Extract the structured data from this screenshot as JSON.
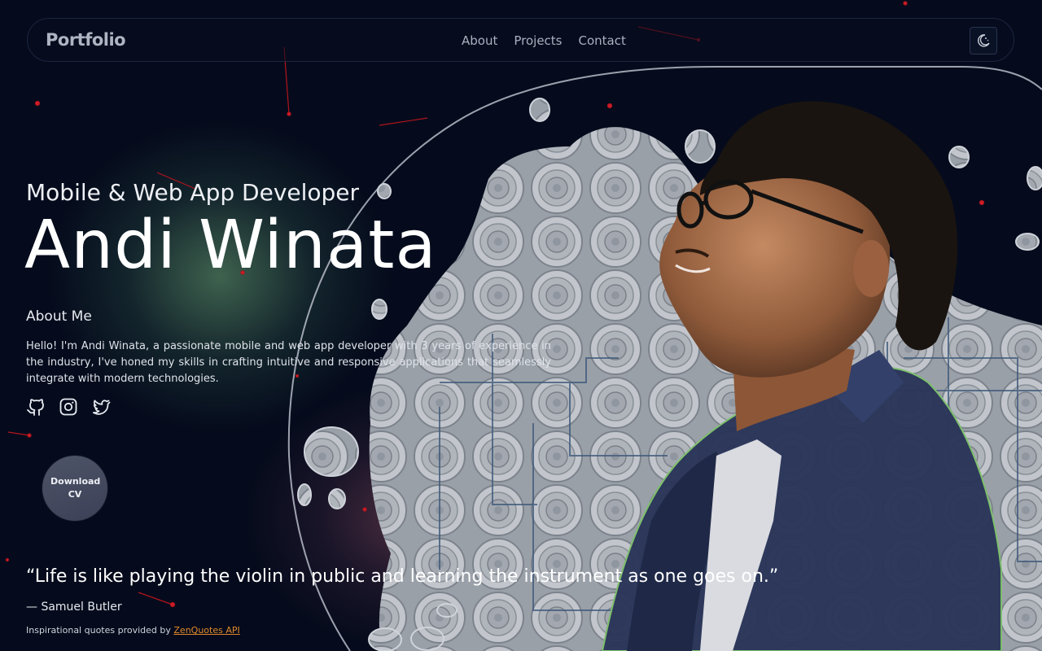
{
  "brand": {
    "logo": "Portfolio"
  },
  "nav": {
    "links": [
      "About",
      "Projects",
      "Contact"
    ],
    "theme_toggle_icon": "moon-icon"
  },
  "hero": {
    "subtitle": "Mobile & Web App Developer",
    "name": "Andi Winata",
    "about_heading": "About Me",
    "about_text": "Hello! I'm Andi Winata, a passionate mobile and web app developer with 3 years of experience in the industry, I've honed my skills in crafting intuitive and responsive applications that seamlessly integrate with modern technologies.",
    "socials": [
      "github-icon",
      "instagram-icon",
      "twitter-icon"
    ],
    "cv_label": "Download CV"
  },
  "quote": {
    "text": "“Life is like playing the violin in public and learning the instrument as one goes on.”",
    "author": "— Samuel Butler",
    "credit_prefix": "Inspirational quotes provided by ",
    "credit_link": "ZenQuotes API"
  },
  "colors": {
    "background": "#050b1c",
    "accent_link": "#e0892a",
    "particle": "#d0202a"
  }
}
